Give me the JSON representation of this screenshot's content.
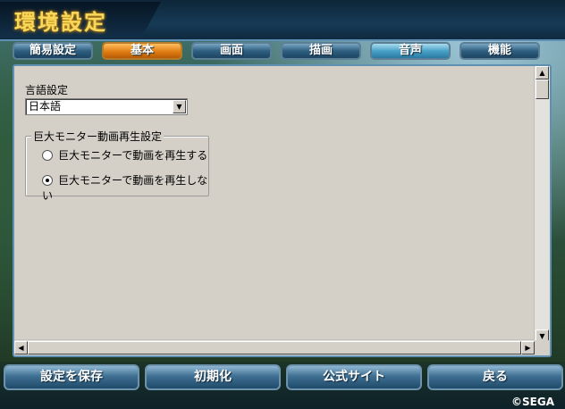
{
  "window": {
    "title": "環境設定"
  },
  "tabs": [
    {
      "label": "簡易設定"
    },
    {
      "label": "基本"
    },
    {
      "label": "画面"
    },
    {
      "label": "描画"
    },
    {
      "label": "音声"
    },
    {
      "label": "機能"
    }
  ],
  "active_tab": "基本",
  "language": {
    "label": "言語設定",
    "value": "日本語"
  },
  "monitor_group": {
    "title": "巨大モニター動画再生設定",
    "options": [
      {
        "label": "巨大モニターで動画を再生する",
        "checked": false
      },
      {
        "label": "巨大モニターで動画を再生しない",
        "checked": true
      }
    ]
  },
  "footer": {
    "buttons": [
      {
        "label": "設定を保存"
      },
      {
        "label": "初期化"
      },
      {
        "label": "公式サイト"
      },
      {
        "label": "戻る"
      }
    ],
    "copyright": "©SEGA"
  },
  "colors": {
    "accent": "#e07d14",
    "tab_blue": "#2f5f80",
    "title_gold": "#f6d85a",
    "panel": "#d4d0c8"
  },
  "icons": {
    "dropdown": "chevron-down-icon",
    "scroll_up": "arrow-up-icon",
    "scroll_down": "arrow-down-icon",
    "scroll_left": "arrow-left-icon",
    "scroll_right": "arrow-right-icon"
  }
}
